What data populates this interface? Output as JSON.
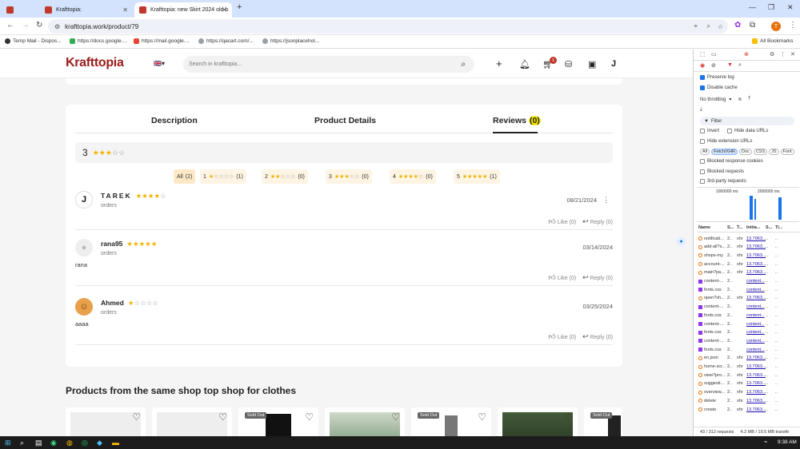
{
  "browser": {
    "tabs": [
      {
        "title": "Krafttopia:",
        "active": false
      },
      {
        "title": "Krafttopia:",
        "active": false
      },
      {
        "title": "Krafttopia: new Skirt 2024 old b",
        "active": true
      }
    ],
    "new_tab": "+",
    "url": "krafttopia.work/product/79",
    "bookmarks": [
      {
        "label": "Temp Mail - Dispos..."
      },
      {
        "label": "https://docs.google...."
      },
      {
        "label": "https://mail.google...."
      },
      {
        "label": "https://qacart.com/..."
      },
      {
        "label": "https://jsonplacehol..."
      }
    ],
    "all_bookmarks": "All Bookmarks",
    "profile_initial": "T"
  },
  "site": {
    "logo": "Krafttopia",
    "search_placeholder": "Search in krafttopia...",
    "cart_badge": "1"
  },
  "product_tabs": {
    "description": "Description",
    "details": "Product Details",
    "reviews": "Reviews",
    "reviews_count": "(0)"
  },
  "rating_summary": {
    "value": "3",
    "stars": 3
  },
  "filters": [
    {
      "label": "All",
      "count": "(2)",
      "stars": 0
    },
    {
      "label": "1",
      "count": "(1)",
      "stars": 1
    },
    {
      "label": "2",
      "count": "(0)",
      "stars": 2
    },
    {
      "label": "3",
      "count": "(0)",
      "stars": 3
    },
    {
      "label": "4",
      "count": "(0)",
      "stars": 4
    },
    {
      "label": "5",
      "count": "(1)",
      "stars": 5
    }
  ],
  "reviews": [
    {
      "name": "TAREK",
      "stars": 4,
      "sub": "orders",
      "date": "08/21/2024",
      "text": "",
      "like": "Like (0)",
      "reply": "Reply (0)"
    },
    {
      "name": "rana95",
      "stars": 5,
      "sub": "orders",
      "date": "03/14/2024",
      "text": "rana",
      "like": "Like (0)",
      "reply": "Reply (0)"
    },
    {
      "name": "Ahmed",
      "stars": 1,
      "sub": "orders",
      "date": "03/25/2024",
      "text": "aaaa",
      "like": "Like (0)",
      "reply": "Reply (0)"
    }
  ],
  "related": {
    "title": "Products from the same shop top shop for clothes",
    "sold_out": "Sold Out"
  },
  "devtools": {
    "preserve_log": "Preserve log",
    "disable_cache": "Disable cache",
    "throttling": "No throttling",
    "filter": "Filter",
    "invert": "Invert",
    "hide_data_urls": "Hide data URLs",
    "hide_ext_urls": "Hide extension URLs",
    "types": [
      "All",
      "Fetch/XHR",
      "Doc",
      "CSS",
      "JS",
      "Font"
    ],
    "blocked_cookies": "Blocked response cookies",
    "blocked_requests": "Blocked requests",
    "third_party": "3rd-party requests",
    "timeline_1": "1000000 ms",
    "timeline_2": "2000000 ms",
    "col_name": "Name",
    "col_s": "S...",
    "col_t": "T...",
    "col_initiator": "Initia...",
    "col_size": "S...",
    "col_time": "Ti...",
    "rows": [
      {
        "name": "notificati...",
        "type": "xhr",
        "init": "13.7063...",
        "kind": "xhr"
      },
      {
        "name": "add-all?s...",
        "type": "xhr",
        "init": "13.7063...",
        "kind": "xhr"
      },
      {
        "name": "shops-my",
        "type": "xhr",
        "init": "13.7063...",
        "kind": "xhr"
      },
      {
        "name": "account-...",
        "type": "xhr",
        "init": "13.7063...",
        "kind": "xhr"
      },
      {
        "name": "main?pa...",
        "type": "xhr",
        "init": "13.7063...",
        "kind": "xhr"
      },
      {
        "name": "content-...",
        "type": "",
        "init": "content...",
        "kind": "doc"
      },
      {
        "name": "fonts.css",
        "type": "",
        "init": "content...",
        "kind": "doc"
      },
      {
        "name": "open?sh...",
        "type": "xhr",
        "init": "13.7063...",
        "kind": "xhr"
      },
      {
        "name": "content-...",
        "type": "",
        "init": "content...",
        "kind": "doc"
      },
      {
        "name": "fonts.css",
        "type": "",
        "init": "content...",
        "kind": "doc"
      },
      {
        "name": "content-...",
        "type": "",
        "init": "content...",
        "kind": "doc"
      },
      {
        "name": "fonts.css",
        "type": "",
        "init": "content...",
        "kind": "doc"
      },
      {
        "name": "content-...",
        "type": "",
        "init": "content...",
        "kind": "doc"
      },
      {
        "name": "fonts.css",
        "type": "",
        "init": "content...",
        "kind": "doc"
      },
      {
        "name": "en.json",
        "type": "xhr",
        "init": "13.7063...",
        "kind": "xhr"
      },
      {
        "name": "home-scr...",
        "type": "xhr",
        "init": "13.7063...",
        "kind": "xhr"
      },
      {
        "name": "view?pro...",
        "type": "xhr",
        "init": "13.7063...",
        "kind": "xhr"
      },
      {
        "name": "suggesti...",
        "type": "xhr",
        "init": "13.7063...",
        "kind": "xhr"
      },
      {
        "name": "overview...",
        "type": "xhr",
        "init": "13.7063...",
        "kind": "xhr"
      },
      {
        "name": "delete",
        "type": "xhr",
        "init": "13.7063...",
        "kind": "xhr"
      },
      {
        "name": "create",
        "type": "xhr",
        "init": "13.7063...",
        "kind": "xhr"
      }
    ],
    "status": "43 / 312 requests",
    "transfer": "4.2 MB / 19.5 MB transfe"
  },
  "taskbar": {
    "time": "9:38 AM"
  }
}
